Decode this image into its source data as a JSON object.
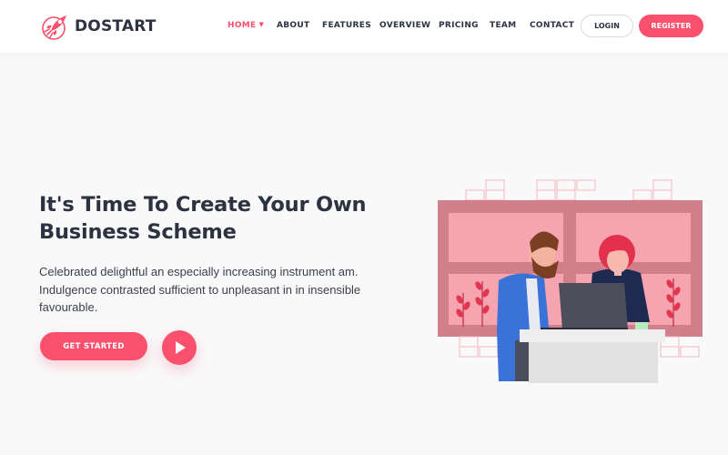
{
  "brand": {
    "name": "DOSTART",
    "icon": "rocket-icon",
    "accent": "#f8506d"
  },
  "nav": {
    "items": [
      {
        "label": "HOME",
        "active": true
      },
      {
        "label": "ABOUT"
      },
      {
        "label": "FEATURES"
      },
      {
        "label": "OVERVIEW"
      },
      {
        "label": "PRICING"
      },
      {
        "label": "TEAM"
      },
      {
        "label": "CONTACT"
      }
    ],
    "login_label": "LOGIN",
    "register_label": "REGISTER"
  },
  "hero": {
    "title_lines": [
      "It's Time To Create Your Own",
      "Business Scheme"
    ],
    "description_lines": [
      "Celebrated delightful an especially increasing instrument am.",
      "Indulgence contrasted sufficient to unpleasant in in insensible",
      "favourable."
    ],
    "cta_label": "GET STARTED",
    "play_icon": "play-icon"
  }
}
